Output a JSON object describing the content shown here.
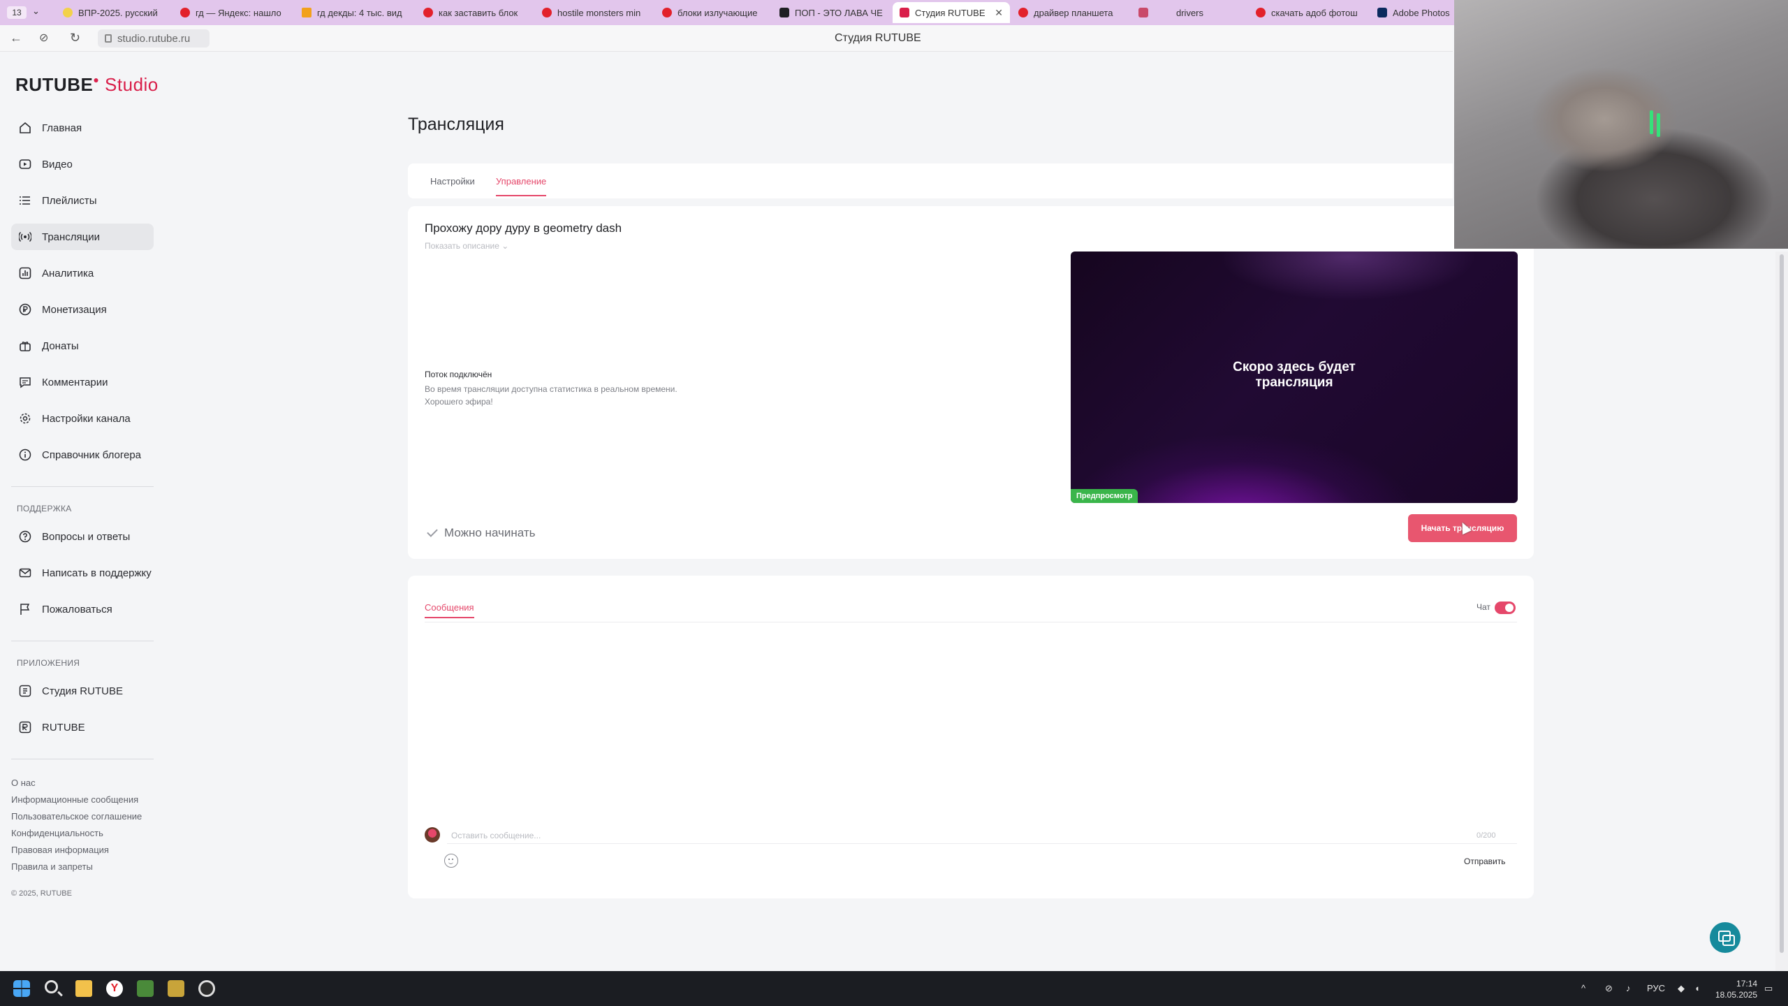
{
  "browser": {
    "tab_count": "13",
    "tabs": [
      {
        "label": "ВПР-2025. русский"
      },
      {
        "label": "гд — Яндекс: нашло"
      },
      {
        "label": "гд декды: 4 тыс. вид"
      },
      {
        "label": "как заставить блок"
      },
      {
        "label": "hostile monsters min"
      },
      {
        "label": "блоки излучающие"
      },
      {
        "label": "ПОП - ЭТО ЛАВА ЧЕ"
      },
      {
        "label": "Студия RUTUBE"
      },
      {
        "label": "драйвер планшета"
      },
      {
        "label": ""
      },
      {
        "label": "drivers"
      },
      {
        "label": "скачать адоб фотош"
      },
      {
        "label": "Adobe Photos"
      }
    ],
    "url": "studio.rutube.ru",
    "page_title": "Студия RUTUBE"
  },
  "logo": {
    "brand": "RUTUBE",
    "product": "Studio"
  },
  "sidebar": {
    "items": [
      {
        "label": "Главная"
      },
      {
        "label": "Видео"
      },
      {
        "label": "Плейлисты"
      },
      {
        "label": "Трансляции"
      },
      {
        "label": "Аналитика"
      },
      {
        "label": "Монетизация"
      },
      {
        "label": "Донаты"
      },
      {
        "label": "Комментарии"
      },
      {
        "label": "Настройки канала"
      },
      {
        "label": "Справочник блогера"
      }
    ],
    "support_title": "ПОДДЕРЖКА",
    "support_items": [
      {
        "label": "Вопросы и ответы"
      },
      {
        "label": "Написать в поддержку"
      },
      {
        "label": "Пожаловаться"
      }
    ],
    "apps_title": "ПРИЛОЖЕНИЯ",
    "apps_items": [
      {
        "label": "Студия RUTUBE"
      },
      {
        "label": "RUTUBE"
      }
    ],
    "footer_links": [
      {
        "label": "О нас"
      },
      {
        "label": "Информационные сообщения"
      },
      {
        "label": "Пользовательское соглашение"
      },
      {
        "label": "Конфиденциальность"
      },
      {
        "label": "Правовая информация"
      },
      {
        "label": "Правила и запреты"
      }
    ],
    "copyright": "© 2025, RUTUBE"
  },
  "main": {
    "title": "Трансляция",
    "tabs": [
      {
        "label": "Настройки"
      },
      {
        "label": "Управление"
      }
    ],
    "stream": {
      "title": "Прохожу дору дуру в geometry dash",
      "show_description": "Показать описание ⌄",
      "status_title": "Поток подключён",
      "status_line1": "Во время трансляции доступна статистика в реальном времени.",
      "status_line2": "Хорошего эфира!",
      "preview_line1": "Скоро здесь будет",
      "preview_line2": "трансляция",
      "preview_badge": "Предпросмотр",
      "ready_label": "Можно начинать",
      "start_button": "Начать трансляцию"
    },
    "chat": {
      "tab_label": "Сообщения",
      "toggle_label": "Чат",
      "input_placeholder": "Оставить сообщение...",
      "counter": "0/200",
      "send_label": "Отправить"
    }
  },
  "taskbar": {
    "lang": "РУС",
    "time": "17:14",
    "date": "18.05.2025"
  },
  "colors": {
    "accent": "#e5476a",
    "start_button": "#e8566f",
    "preview_badge": "#3ab54a",
    "help_button": "#168a9c"
  }
}
